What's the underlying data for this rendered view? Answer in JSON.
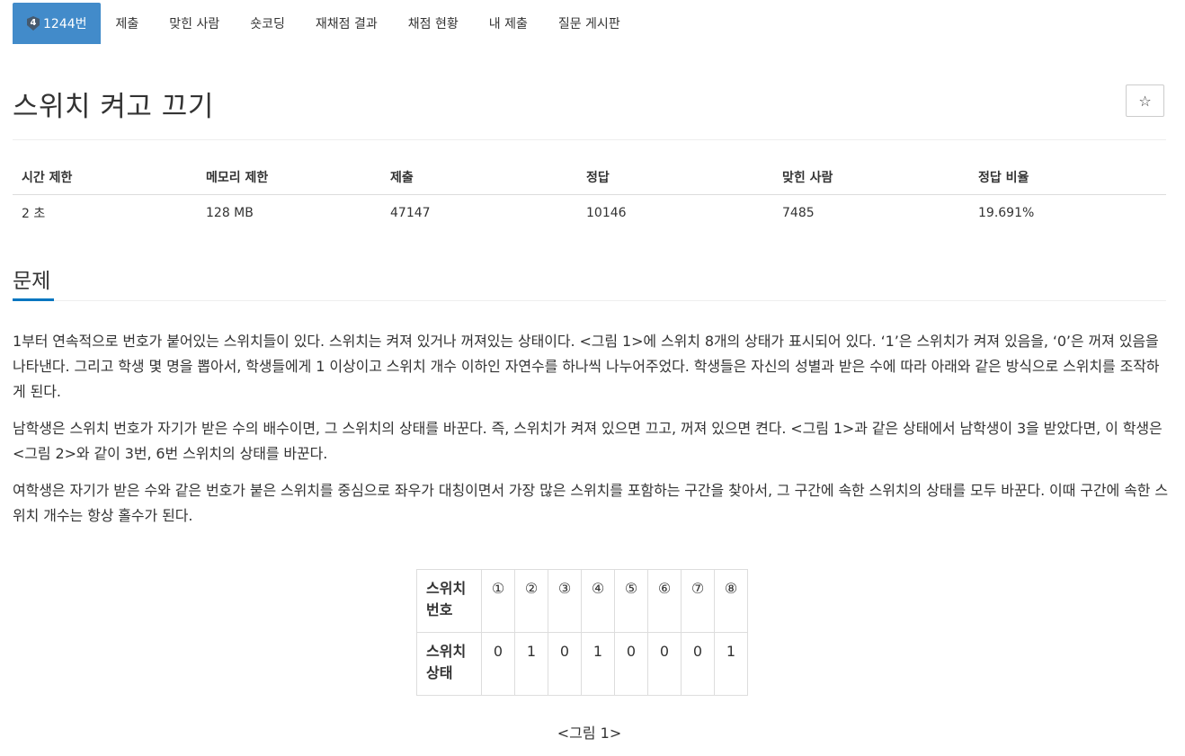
{
  "nav": {
    "tier_badge": "4",
    "tabs": [
      {
        "label": "1244번",
        "active": true
      },
      {
        "label": "제출"
      },
      {
        "label": "맞힌 사람"
      },
      {
        "label": "숏코딩"
      },
      {
        "label": "재채점 결과"
      },
      {
        "label": "채점 현황"
      },
      {
        "label": "내 제출"
      },
      {
        "label": "질문 게시판"
      }
    ]
  },
  "problem": {
    "title": "스위치 켜고 끄기",
    "star_icon": "☆"
  },
  "info": {
    "headers": [
      "시간 제한",
      "메모리 제한",
      "제출",
      "정답",
      "맞힌 사람",
      "정답 비율"
    ],
    "values": [
      "2 초",
      "128 MB",
      "47147",
      "10146",
      "7485",
      "19.691%"
    ]
  },
  "section": {
    "title": "문제"
  },
  "description": {
    "paragraphs": [
      "1부터 연속적으로 번호가 붙어있는 스위치들이 있다. 스위치는 켜져 있거나 꺼져있는 상태이다. <그림 1>에 스위치 8개의 상태가 표시되어 있다. ‘1’은 스위치가 켜져 있음을, ‘0’은 꺼져 있음을 나타낸다. 그리고 학생 몇 명을 뽑아서, 학생들에게 1 이상이고 스위치 개수 이하인 자연수를 하나씩 나누어주었다. 학생들은 자신의 성별과 받은 수에 따라 아래와 같은 방식으로 스위치를 조작하게 된다.",
      "남학생은 스위치 번호가 자기가 받은 수의 배수이면, 그 스위치의 상태를 바꾼다. 즉, 스위치가 켜져 있으면 끄고, 꺼져 있으면 켠다. <그림 1>과 같은 상태에서 남학생이 3을 받았다면, 이 학생은 <그림 2>와 같이 3번, 6번 스위치의 상태를 바꾼다.",
      "여학생은 자기가 받은 수와 같은 번호가 붙은 스위치를 중심으로 좌우가 대칭이면서 가장 많은 스위치를 포함하는 구간을 찾아서, 그 구간에 속한 스위치의 상태를 모두 바꾼다. 이때 구간에 속한 스위치 개수는 항상 홀수가 된다."
    ]
  },
  "figure": {
    "row1_header": "스위치 번호",
    "row2_header": "스위치 상태",
    "numbers": [
      "①",
      "②",
      "③",
      "④",
      "⑤",
      "⑥",
      "⑦",
      "⑧"
    ],
    "states": [
      "0",
      "1",
      "0",
      "1",
      "0",
      "0",
      "0",
      "1"
    ],
    "caption": "<그림 1>"
  },
  "colors": {
    "accent": "#428bca",
    "section_underline": "#0076c0",
    "badge": "#465a6e"
  }
}
